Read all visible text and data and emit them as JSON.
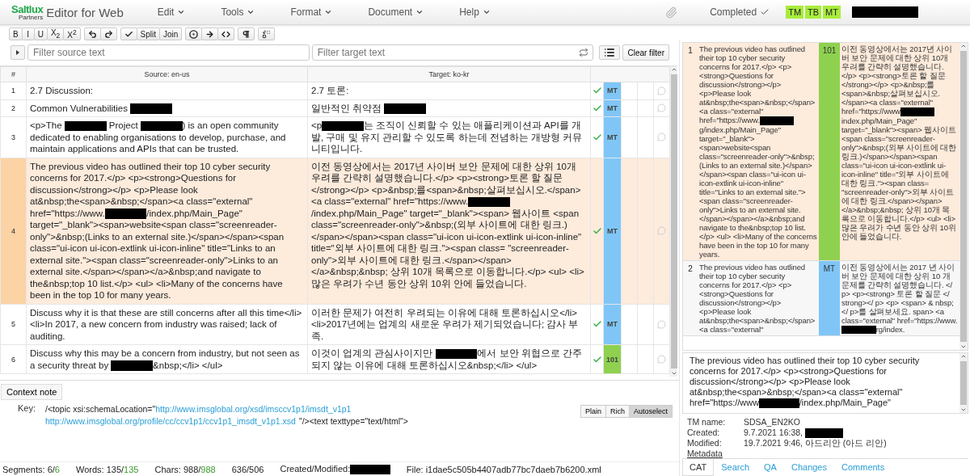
{
  "app": {
    "brand": "Saltlux",
    "brand_sub": "Partners",
    "title": "Editor for Web"
  },
  "menu": [
    {
      "label": "Edit"
    },
    {
      "label": "Tools"
    },
    {
      "label": "Format"
    },
    {
      "label": "Document"
    },
    {
      "label": "Help"
    }
  ],
  "header_right": {
    "status": "Completed",
    "badges": [
      "TM",
      "TB",
      "MT"
    ]
  },
  "toolbar": [
    {
      "buttons": [
        {
          "kind": "text",
          "label": "B"
        },
        {
          "kind": "text",
          "label": "I"
        },
        {
          "kind": "text",
          "label": "U"
        },
        {
          "kind": "text",
          "label": "X$_{2}$"
        },
        {
          "kind": "text",
          "label": "X$^{2}$"
        }
      ]
    },
    {
      "buttons": [
        {
          "kind": "undo"
        },
        {
          "kind": "redo"
        }
      ]
    },
    {
      "buttons": [
        {
          "kind": "check"
        },
        {
          "kind": "text",
          "label": "Split"
        },
        {
          "kind": "text",
          "label": "Join"
        }
      ]
    },
    {
      "buttons": [
        {
          "kind": "record"
        },
        {
          "kind": "arrow"
        },
        {
          "kind": "code"
        }
      ]
    },
    {
      "buttons": [
        {
          "kind": "pilcrow"
        }
      ]
    },
    {
      "buttons": [
        {
          "kind": "replace"
        }
      ]
    }
  ],
  "filters": {
    "source_placeholder": "Filter source text",
    "target_placeholder": "Filter target text",
    "clear": "Clear filter"
  },
  "table": {
    "columns": [
      "#",
      "Source: en-us",
      "Target: ko-kr"
    ],
    "rows": [
      {
        "num": "1",
        "selected": false,
        "confirmed": true,
        "status": {
          "label": "MT",
          "color": "#7fc6f7"
        },
        "source": [
          {
            "kind": "text",
            "text": "2.7 Discussion:"
          }
        ],
        "target": [
          {
            "kind": "text",
            "text": "2.7 토론:"
          }
        ]
      },
      {
        "num": "2",
        "selected": false,
        "confirmed": true,
        "status": {
          "label": "MT",
          "color": "#7fc6f7"
        },
        "source": [
          {
            "kind": "text",
            "text": "Common Vulnerabilities "
          },
          {
            "kind": "redacted"
          }
        ],
        "target": [
          {
            "kind": "text",
            "text": "일반적인 취약점 "
          },
          {
            "kind": "redacted"
          }
        ]
      },
      {
        "num": "3",
        "selected": false,
        "confirmed": true,
        "status": {
          "label": "MT",
          "color": "#7fc6f7"
        },
        "source": [
          {
            "kind": "text",
            "text": "<p>The "
          },
          {
            "kind": "redacted"
          },
          {
            "kind": "text",
            "text": " Project "
          },
          {
            "kind": "redacted"
          },
          {
            "kind": "text",
            "text": ") is an open community dedicated to enabling organisations to develop, purchase, and maintain applications and APIs that can be trusted."
          }
        ],
        "target": [
          {
            "kind": "text",
            "text": "<p"
          },
          {
            "kind": "redacted"
          },
          {
            "kind": "text",
            "text": "는 조직이 신뢰할 수 있는 애플리케이션과 API를 개발, 구매 및 유지 관리할 수 있도록 하는데 전념하는 개방형 커뮤니티입니다."
          }
        ]
      },
      {
        "num": "4",
        "selected": true,
        "confirmed": true,
        "status": {
          "label": "MT",
          "color": "#7fc6f7"
        },
        "source": [
          {
            "kind": "text",
            "text": "The previous video has outlined their top 10 cyber security concerns for 2017.</p> <p><strong>Questions for discussion</strong></p> <p>Please look at&nbsp;the<span>&nbsp;</span><a class=\"external\" href=\"https://www."
          },
          {
            "kind": "redacted"
          },
          {
            "kind": "text",
            "text": "/index.php/Main_Page\" target=\"_blank\"><span>website<span class=\"screenreader-only\">&nbsp;(Links to an external site.)</span></span><span class=\"ui-icon ui-icon-extlink ui-icon-inline\" title=\"Links to an external site.\"><span class=\"screenreader-only\">Links to an external site.</span></span></a>&nbsp;and navigate to the&nbsp;top 10 list.</p> <ul> <li>Many of the concerns have been in the top 10 for many years."
          }
        ],
        "target": [
          {
            "kind": "text",
            "text": "이전 동영상에서는 2017년 사이버 보안 문제에 대한 상위 10개 우려를 간략히 설명했습니다.</p> <p><strong>토론 할 질문 </strong></p> <p>&nbsp;를<span>&nbsp;살펴보십시오.</span><a class=\"external\" href=\"https://www."
          },
          {
            "kind": "redacted"
          },
          {
            "kind": "text",
            "text": "/index.php/Main_Page\" target=\"_blank\"><span> 웹사이트 <span class=\"screenreader-only\">&nbsp;(외부 사이트에 대한 링크.)</span></span><span class=\"ui-icon ui-icon-extlink ui-icon-inline\" title=\"외부 사이트에 대한 링크.\"><span class= \"screenreader-only\">외부 사이트에 대한 링크.</span></span></a>&nbsp;&nbsp; 상위 10개 목록으로 이동합니다.</p> <ul> <li>많은 우려가 수년 동안 상위 10위 안에 들었습니다."
          }
        ]
      },
      {
        "num": "5",
        "selected": false,
        "confirmed": true,
        "status": {
          "label": "MT",
          "color": "#7fc6f7"
        },
        "source": [
          {
            "kind": "text",
            "text": "Discuss why it is that these are still concerns after all this time</li> <li>In 2017, a new concern from industry was raised; lack of auditing."
          }
        ],
        "target": [
          {
            "kind": "text",
            "text": "이러한 문제가 여전히 우려되는 이유에 대해 토론하십시오</li> <li>2017년에는 업계의 새로운 우려가 제기되었습니다; 감사 부족."
          }
        ]
      },
      {
        "num": "6",
        "selected": false,
        "confirmed": true,
        "status": {
          "label": "101",
          "color": "#8ed14f"
        },
        "source": [
          {
            "kind": "text",
            "text": "Discuss why this may be a concern from industry, but not seen as a security threat by "
          },
          {
            "kind": "redacted"
          },
          {
            "kind": "text",
            "text": "&nbsp;</li> </ul>"
          }
        ],
        "target": [
          {
            "kind": "text",
            "text": "이것이 업계의 관심사이지만 "
          },
          {
            "kind": "redacted"
          },
          {
            "kind": "text",
            "text": "에서 보안 위협으로 간주되지 않는 이유에 대해 토론하십시오&nbsp;</li> </ul>"
          }
        ]
      }
    ]
  },
  "context": {
    "tab": "Context note",
    "key_label": "Key:",
    "key": [
      {
        "kind": "text",
        "text": "/<topic xsi:schemaLocation=\""
      },
      {
        "kind": "link",
        "text": "http://www.imsglobal.org/xsd/imsccv1p1/imsdt_v1p1"
      },
      {
        "kind": "link",
        "text": "http://www.imsglobal.org/profile/cc/ccv1p1/ccv1p1_imsdt_v1p1.xsd"
      },
      {
        "kind": "text",
        "text": "\"/><text texttype=\"text/html\">"
      }
    ],
    "modes": [
      {
        "label": "Plain",
        "selected": false
      },
      {
        "label": "Rich",
        "selected": false
      },
      {
        "label": "Autoselect",
        "selected": true
      }
    ]
  },
  "status_bar": [
    {
      "kind": "count",
      "label": "Segments:",
      "value": "6/",
      "total": "6"
    },
    {
      "kind": "count",
      "label": "Words:",
      "value": "135/",
      "total": "135"
    },
    {
      "kind": "count",
      "label": "Chars:",
      "value": "988/",
      "total": "988"
    },
    {
      "kind": "text",
      "parts": [
        {
          "kind": "text",
          "text": "636/506"
        }
      ]
    },
    {
      "kind": "text",
      "parts": [
        {
          "kind": "text",
          "text": "Created/Modified:"
        },
        {
          "kind": "redacted"
        }
      ]
    },
    {
      "kind": "text",
      "parts": [
        {
          "kind": "text",
          "text": "File: i1dae5c505b4407adb77bc7daeb7b6200.xml"
        }
      ]
    }
  ],
  "side": {
    "matches": [
      {
        "num": "1",
        "selected": true,
        "match": {
          "label": "101",
          "color": "#8ed14f"
        },
        "source": [
          {
            "kind": "text",
            "text": "The previous video has outlined their top 10 cyber security concerns for 2017.</p> <p><strong>Questions for discussion</strong></p> <p>Please look at&nbsp;the<span>&nbsp;</span><a class=\"external\" href=\"https://www."
          },
          {
            "kind": "redacted"
          },
          {
            "kind": "text",
            "text": "g/index.php/Main_Page\" target=\"_blank\"><span>website<span class=\"screenreader-only\">&nbsp;(Links to an external site.)</span></span><span class=\"ui-icon ui-icon-extlink ui-icon-inline\" title=\"Links to an external site.\"><span class=\"screenreader-only\">Links to an external site.</span></span></a>&nbsp;and navigate to the&nbsp;top 10 list.</p> <ul> <li>Many of the concerns have been in the top 10 for many years."
          }
        ],
        "target": [
          {
            "kind": "text",
            "text": "이전 동영상에서는 2017년 사이버 보안 문제에 대한 상위 10개 우려를 간략히 설명했습니다.</p> <p><strong>토론 할 질문 </strong></p> <p>&nbsp;를<span>&nbsp;살펴보십시오.</span><a class=\"external\" href=\"https://www"
          },
          {
            "kind": "redacted"
          },
          {
            "kind": "text",
            "text": "index.php/Main_Page\" target=\"_blank\"><span> 웹사이트 <span class=\"screenreader-only\">&nbsp;(외부 사이트에 대한 링크.)</span></span><span class=\"ui-icon ui-icon-extlink ui-icon-inline\" title=\"외부 사이트에 대한 링크.\"><span class= \"screenreader-only\">외부 사이트에 대한 링크.</span></span></a>&nbsp;&nbsp; 상위 10개 목록으로 이동합니다.</p> <ul> <li>많은 우려가 수년 동안 상위 10위 안에 들었습니다."
          }
        ]
      },
      {
        "num": "2",
        "selected": false,
        "match": {
          "label": "MT",
          "color": "#7fc6f7"
        },
        "source": [
          {
            "kind": "text",
            "text": "The previous video has outlined their top 10 cyber security concerns for 2017.</p> <p><strong>Questions for discussion</strong></p> <p>Please look at&nbsp;the<span>&nbsp;</span><a class=\"external\""
          }
        ],
        "target": [
          {
            "kind": "text",
            "text": "이전 동영상에서는 2017 년 사이버 보안 문제에 대한 상위 10 개 문제를 간략히 설명했습니다. </ p> <p><strong> 토론 할 질문 </ strong></ p> <p> <span> & nbsp; </ p>를 살펴보세요. span> <a class=\"external\" href=\"https://www."
          },
          {
            "kind": "redacted"
          },
          {
            "kind": "text",
            "text": "rg/index."
          }
        ]
      }
    ],
    "preview": [
      {
        "kind": "text",
        "text": "The previous video has outlined their top 10 cyber security concerns for 2017.</p> <p><strong>Questions for discussion</strong></p> <p>Please look at&nbsp;the<span>&nbsp;</span><a class=\"external\" href=\"https://www"
      },
      {
        "kind": "redacted"
      },
      {
        "kind": "text",
        "text": "/index.php/Main_Page\""
      }
    ],
    "info": [
      {
        "label": "TM name:",
        "value": [
          {
            "kind": "text",
            "text": "SDSA_EN2KO"
          }
        ]
      },
      {
        "label": "Created:",
        "value": [
          {
            "kind": "text",
            "text": "9.7.2021 16:38, "
          },
          {
            "kind": "redacted"
          }
        ]
      },
      {
        "label": "Modified:",
        "value": [
          {
            "kind": "text",
            "text": "19.7.2021 9:46, 아드리안 (아드 리안)"
          }
        ]
      }
    ],
    "metadata": "Metadata",
    "tabs": [
      {
        "label": "CAT",
        "selected": true
      },
      {
        "label": "Search",
        "selected": false
      },
      {
        "label": "QA",
        "selected": false
      },
      {
        "label": "Changes",
        "selected": false
      },
      {
        "label": "Comments",
        "selected": false
      }
    ]
  }
}
